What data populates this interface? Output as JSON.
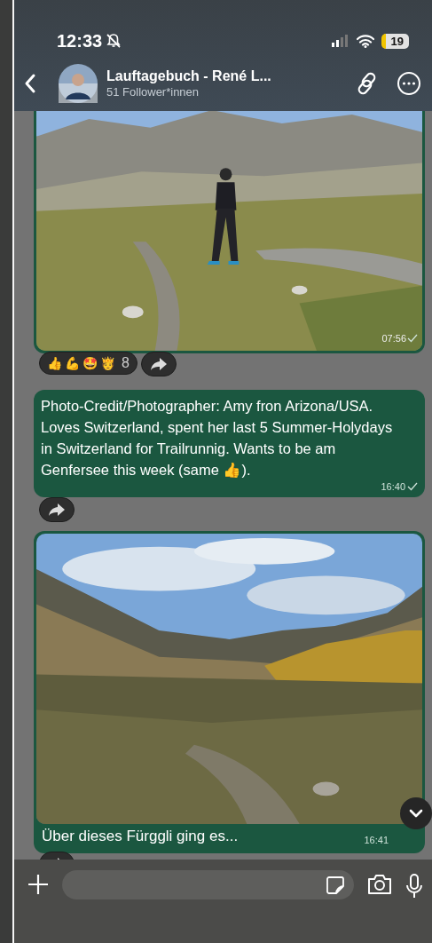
{
  "status_bar": {
    "time": "12:33",
    "battery": "19"
  },
  "header": {
    "title": "Lauftagebuch - René L...",
    "subtitle": "51 Follower*innen"
  },
  "messages": [
    {
      "time": "07:56",
      "reactions": {
        "emojis": [
          "👍",
          "💪",
          "🤩",
          "🫅"
        ],
        "count": "8"
      }
    },
    {
      "kind": "text",
      "text": "Photo-Credit/Photographer: Amy fron Arizona/USA. Loves Switzerland, spent her last 5 Summer-Holydays in Switzerland for Trailrunnig. Wants to be am Genfersee this week (same 👍).",
      "time": "16:40"
    },
    {
      "caption": "Über dieses Fürggli ging es...",
      "time": "16:41"
    }
  ]
}
